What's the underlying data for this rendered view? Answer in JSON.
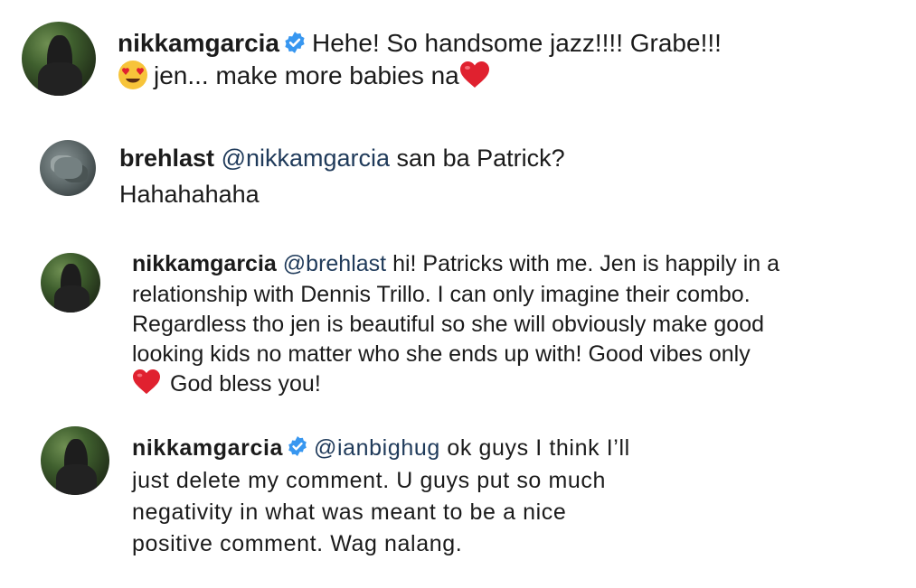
{
  "comments": [
    {
      "username": "nikkamgarcia",
      "verified": true,
      "line1_text": "Hehe! So handsome jazz!!!! Grabe!!!",
      "line2_text": "jen... make more babies na",
      "emojis": [
        "smiling-face-with-heart-eyes-emoji",
        "red-heart-emoji"
      ]
    },
    {
      "username": "brehlast",
      "verified": false,
      "mention": "@nikkamgarcia",
      "line1_text": "san ba Patrick?",
      "line2_text": "Hahahahaha"
    },
    {
      "username": "nikkamgarcia",
      "verified": false,
      "mention": "@brehlast",
      "line1_text": "hi! Patricks with me. Jen is happily in a",
      "line2_text": "relationship with Dennis Trillo. I can only imagine their combo.",
      "line3_text": "Regardless tho jen is beautiful so she will obviously make good",
      "line4_text": "looking kids no matter who she ends up with! Good vibes only",
      "line5_text": "God bless you!",
      "emojis": [
        "red-heart-emoji"
      ]
    },
    {
      "username": "nikkamgarcia",
      "verified": true,
      "mention": "@ianbighug",
      "line1_text": "ok guys I think I’ll",
      "line2_text": "just delete my comment. U guys put so much",
      "line3_text": "negativity in what was meant to be a nice",
      "line4_text": "positive comment. Wag nalang."
    }
  ],
  "colors": {
    "text": "#1b1b1b",
    "mention": "#1f3a5a",
    "verified_badge": "#3897f0",
    "heart": "#e0212f",
    "emoji_face": "#f7c43a"
  }
}
